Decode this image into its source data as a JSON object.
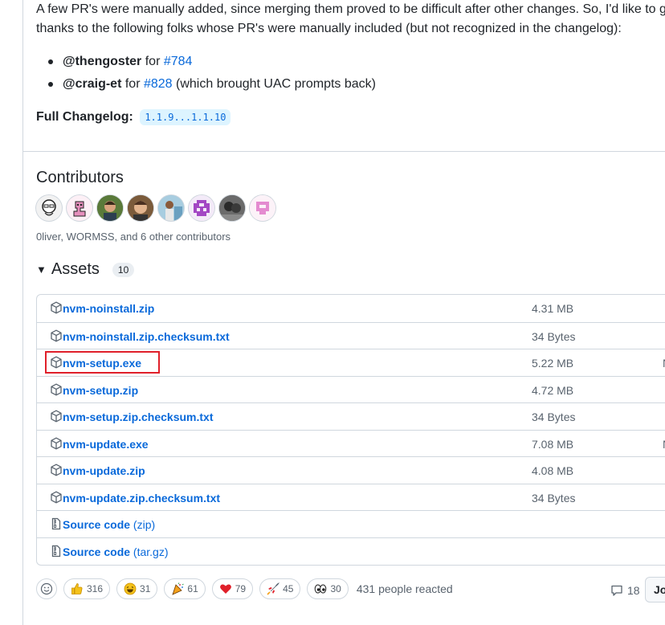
{
  "intro": {
    "line1": "A few PR's were manually added, since merging them proved to be difficult after other changes. So, I'd like to g",
    "line2": "thanks to the following folks whose PR's were manually included (but not recognized in the changelog):"
  },
  "bullets": [
    {
      "user": "@thengoster",
      "text": " for ",
      "pr": "#784",
      "suffix": ""
    },
    {
      "user": "@craig-et",
      "text": " for ",
      "pr": "#828",
      "suffix": " (which brought UAC prompts back)"
    }
  ],
  "changelog": {
    "label": "Full Changelog:",
    "range": "1.1.9...1.1.10"
  },
  "contributors": {
    "title": "Contributors",
    "names": "0liver, WORMSS, and 6 other contributors"
  },
  "assets": {
    "title": "Assets",
    "count": "10",
    "rows": [
      {
        "name": "nvm-noinstall.zip",
        "suffix": "",
        "size": "4.31 MB",
        "date": "",
        "icon": "package-icon"
      },
      {
        "name": "nvm-noinstall.zip.checksum.txt",
        "suffix": "",
        "size": "34 Bytes",
        "date": "",
        "icon": "package-icon"
      },
      {
        "name": "nvm-setup.exe",
        "suffix": "",
        "size": "5.22 MB",
        "date": "N",
        "icon": "package-icon"
      },
      {
        "name": "nvm-setup.zip",
        "suffix": "",
        "size": "4.72 MB",
        "date": "",
        "icon": "package-icon"
      },
      {
        "name": "nvm-setup.zip.checksum.txt",
        "suffix": "",
        "size": "34 Bytes",
        "date": "",
        "icon": "package-icon"
      },
      {
        "name": "nvm-update.exe",
        "suffix": "",
        "size": "7.08 MB",
        "date": "N",
        "icon": "package-icon"
      },
      {
        "name": "nvm-update.zip",
        "suffix": "",
        "size": "4.08 MB",
        "date": "",
        "icon": "package-icon"
      },
      {
        "name": "nvm-update.zip.checksum.txt",
        "suffix": "",
        "size": "34 Bytes",
        "date": "",
        "icon": "package-icon"
      },
      {
        "name": "Source code",
        "suffix": " (zip)",
        "size": "",
        "date": "",
        "icon": "file-zip-icon"
      },
      {
        "name": "Source code",
        "suffix": " (tar.gz)",
        "size": "",
        "date": "",
        "icon": "file-zip-icon"
      }
    ]
  },
  "reactions": {
    "items": [
      {
        "icon": "thumbs-up-icon",
        "count": "316"
      },
      {
        "icon": "laugh-icon",
        "count": "31"
      },
      {
        "icon": "tada-icon",
        "count": "61"
      },
      {
        "icon": "heart-icon",
        "count": "79"
      },
      {
        "icon": "rocket-icon",
        "count": "45"
      },
      {
        "icon": "eyes-icon",
        "count": "30"
      }
    ],
    "summary": "431 people reacted"
  },
  "comments": {
    "count": "18"
  },
  "join_button": {
    "label": "Jo"
  },
  "colors": {
    "link": "#0969da",
    "highlight": "#e0202a",
    "border": "#d0d7de",
    "muted": "#59636e"
  }
}
